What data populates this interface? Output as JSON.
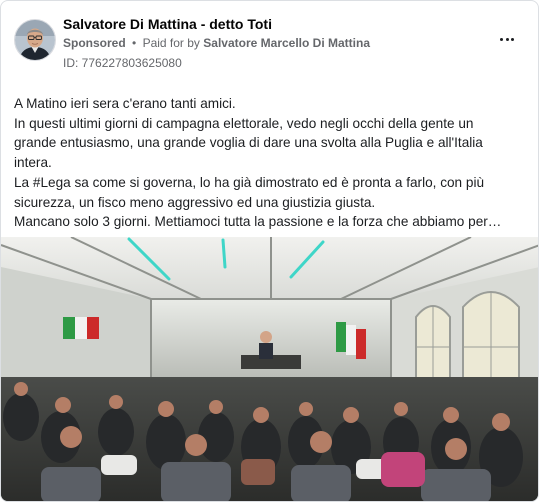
{
  "post": {
    "author": "Salvatore Di Mattina - detto Toti",
    "sponsored_label": "Sponsored",
    "separator": "•",
    "paid_for_prefix": "Paid for by",
    "payer": "Salvatore Marcello Di Mattina",
    "ad_id": "ID: 776227803625080",
    "text_lines": [
      "A Matino ieri sera c'erano tanti amici.",
      "In questi ultimi giorni di campagna elettorale, vedo negli occhi della gente un",
      "grande entusiasmo, una grande voglia di dare una svolta alla Puglia e all'Italia",
      "intera.",
      "La #Lega sa come si governa, lo ha già dimostrato ed è pronta a farlo, con più",
      "sicurezza, un fisco meno aggressivo ed una giustizia giusta.",
      "Mancano solo 3 giorni. Mettiamoci tutta la passione e la forza che abbiamo per…"
    ]
  },
  "icons": {
    "more_options": "more-horizontal-icon"
  },
  "colors": {
    "text_primary": "#1c1e21",
    "text_secondary": "#65676b",
    "tent_light_teal": "#3fd6c8"
  }
}
